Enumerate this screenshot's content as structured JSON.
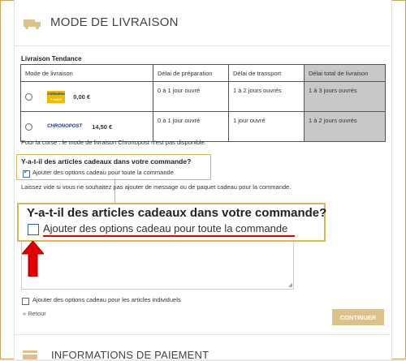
{
  "section": {
    "title": "MODE DE LIVRAISON",
    "icon": "truck-icon"
  },
  "subhead": "Livraison Tendance",
  "table": {
    "headers": [
      "Mode de livraison",
      "Délai de préparation",
      "Délai de transport",
      "Délai total de livraison"
    ],
    "rows": [
      {
        "carrier": "Colissimo",
        "carrier_sub": "+ suivi",
        "price": "0,00 €",
        "prep": "0 à 1 jour ouvré",
        "transport": "1 à 2 jours ouvrés",
        "total": "1 à 3 jours ouvrés"
      },
      {
        "carrier": "CHRONOPOST",
        "price": "14,50 €",
        "prep": "0 à 1 jour ouvré",
        "transport": "1 jour ouvré",
        "total": "1 à 2 jours ouvrés"
      }
    ]
  },
  "corse_note": "Pour la corse : le mode de livraison Chronopost n'est pas disponible.",
  "gift": {
    "question": "Y-a-t-il des articles cadeaux dans votre commande?",
    "option_all": "Ajouter des options cadeau pour toute la commande",
    "option_all_checked": true,
    "help": "Laissez vide si vous ne souhaitez pas ajouter de message ou de paquet cadeau pour la commande.",
    "option_individual": "Ajouter des options cadeau pour les articles individuels"
  },
  "zoom": {
    "question": "Y-a-t-il des articles cadeaux dans votre commande?",
    "option": "Ajouter des options cadeau pour toute la commande"
  },
  "nav": {
    "back": "« Retour",
    "continue": "CONTINUER"
  },
  "next_section": {
    "title": "INFORMATIONS DE PAIEMENT",
    "icon": "credit-card-icon"
  },
  "colors": {
    "accent": "#d9b55b",
    "button": "#dcc28a",
    "arrow": "#e00000",
    "highlight_cell": "#c8c8c8"
  }
}
